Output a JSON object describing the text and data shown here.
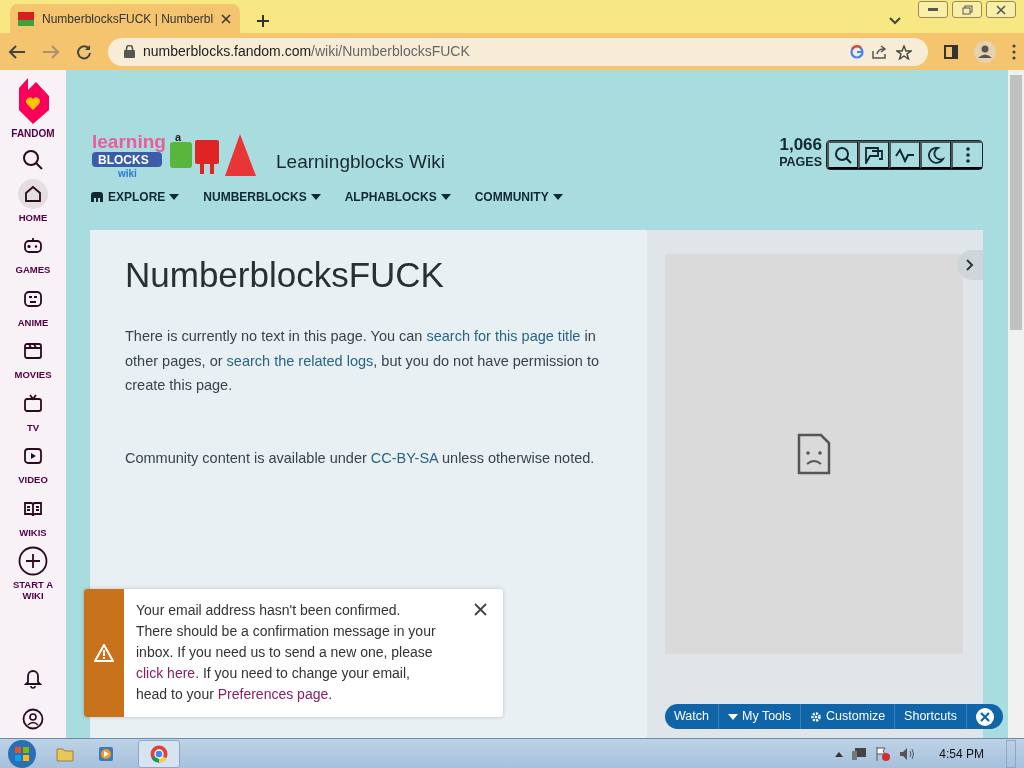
{
  "browser": {
    "tab_title": "NumberblocksFUCK | Numberbl",
    "url_host": "numberblocks.fandom.com",
    "url_path": "/wiki/NumberblocksFUCK"
  },
  "rail": {
    "logo_label": "FANDOM",
    "items": [
      {
        "label": "HOME",
        "kind": "home",
        "selected": true
      },
      {
        "label": "GAMES",
        "kind": "games",
        "selected": false
      },
      {
        "label": "ANIME",
        "kind": "anime",
        "selected": false
      },
      {
        "label": "MOVIES",
        "kind": "movies",
        "selected": false
      },
      {
        "label": "TV",
        "kind": "tv",
        "selected": false
      },
      {
        "label": "VIDEO",
        "kind": "video",
        "selected": false
      },
      {
        "label": "WIKIS",
        "kind": "wikis",
        "selected": false
      },
      {
        "label": "START A WIKI",
        "kind": "start",
        "selected": false
      }
    ]
  },
  "wiki": {
    "logo_texts": [
      "learning",
      "BLOCKS",
      "wiki",
      "a"
    ],
    "name": "Learningblocks Wiki",
    "page_count": "1,066",
    "page_count_label": "PAGES",
    "nav": [
      {
        "label": "EXPLORE",
        "kind": "explore"
      },
      {
        "label": "NUMBERBLOCKS",
        "kind": "plain"
      },
      {
        "label": "ALPHABLOCKS",
        "kind": "plain"
      },
      {
        "label": "COMMUNITY",
        "kind": "plain"
      }
    ]
  },
  "article": {
    "title": "NumberblocksFUCK",
    "paragraphs": [
      [
        {
          "text": "There is currently no text in this page. You can ",
          "link": false
        },
        {
          "text": "search for this page title",
          "link": true
        },
        {
          "text": " in other pages, or ",
          "link": false
        },
        {
          "text": "search the related logs",
          "link": true
        },
        {
          "text": ", but you do not have permission to create this page.",
          "link": false
        }
      ],
      [
        {
          "text": "Community content is available under ",
          "link": false
        },
        {
          "text": "CC-BY-SA",
          "link": true
        },
        {
          "text": " unless otherwise noted.",
          "link": false
        }
      ]
    ]
  },
  "notice": {
    "segments": [
      {
        "text": "Your email address hasn't been confirmed. There should be a confirmation message in your inbox. If you need us to send a new one, please ",
        "link": false
      },
      {
        "text": "click here",
        "link": true
      },
      {
        "text": ". If you need to change your email, head to your ",
        "link": false
      },
      {
        "text": "Preferences page",
        "link": true
      },
      {
        "text": ".",
        "link": false
      }
    ]
  },
  "toolbar": [
    {
      "label": "Watch",
      "kind": "plain"
    },
    {
      "label": "My Tools",
      "kind": "dropdown"
    },
    {
      "label": "Customize",
      "kind": "gear"
    },
    {
      "label": "Shortcuts",
      "kind": "plain"
    }
  ],
  "taskbar": {
    "clock": "4:54 PM"
  }
}
